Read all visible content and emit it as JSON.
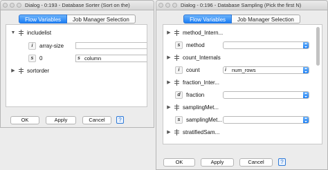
{
  "left_dialog": {
    "title": "Dialog - 0:193 - Database Sorter (Sort on the)",
    "tabs": [
      "Flow Variables",
      "Job Manager Selection"
    ],
    "tree": {
      "root_label": "includelist",
      "child1_label": "array-size",
      "child2_index": "0",
      "child2_value": "column",
      "sibling_label": "sortorder"
    },
    "buttons": {
      "ok": "OK",
      "apply": "Apply",
      "cancel": "Cancel",
      "help": "?"
    }
  },
  "right_dialog": {
    "title": "Dialog - 0:196 - Database Sampling (Pick the first N)",
    "tabs": [
      "Flow Variables",
      "Job Manager Selection"
    ],
    "rows": [
      {
        "label": "method_Intern...",
        "type": "group"
      },
      {
        "label": "method",
        "type": "field",
        "value": ""
      },
      {
        "label": "count_Internals",
        "type": "group"
      },
      {
        "label": "count",
        "type": "field",
        "value": "num_rows"
      },
      {
        "label": "fraction_Inter...",
        "type": "group"
      },
      {
        "label": "fraction",
        "type": "field",
        "value": ""
      },
      {
        "label": "samplingMet...",
        "type": "group"
      },
      {
        "label": "samplingMet...",
        "type": "field",
        "value": ""
      },
      {
        "label": "stratifiedSam...",
        "type": "group"
      }
    ],
    "buttons": {
      "ok": "OK",
      "apply": "Apply",
      "cancel": "Cancel",
      "help": "?"
    }
  },
  "colors": {
    "accent": "#1c7ff6",
    "background": "#ececec"
  }
}
